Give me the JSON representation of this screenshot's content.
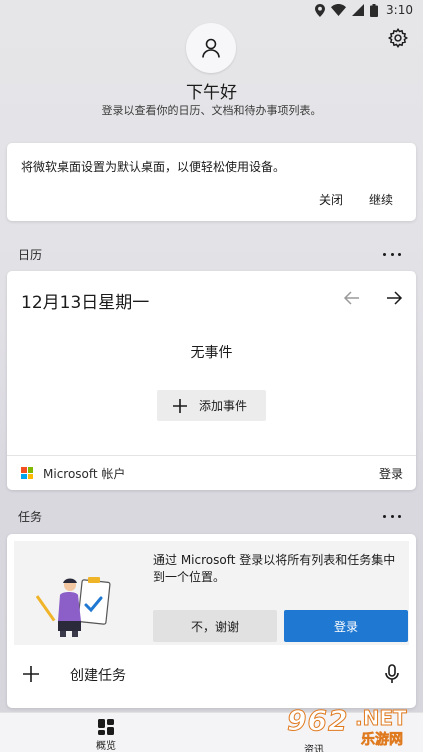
{
  "status_bar": {
    "time": "3:10",
    "icons": [
      "location-icon",
      "wifi-icon",
      "signal-icon",
      "battery-icon"
    ]
  },
  "header": {
    "avatar_icon": "person-icon",
    "settings_icon": "gear-icon",
    "greeting": "下午好",
    "subtitle": "登录以查看你的日历、文档和待办事项列表。"
  },
  "banner": {
    "text": "将微软桌面设置为默认桌面，以便轻松使用设备。",
    "close_label": "关闭",
    "continue_label": "继续"
  },
  "calendar": {
    "section_label": "日历",
    "date": "12月13日星期一",
    "empty_text": "无事件",
    "add_event_label": "添加事件",
    "account_label": "Microsoft 帐户",
    "signin_label": "登录"
  },
  "tasks": {
    "section_label": "任务",
    "promo_text": "通过 Microsoft 登录以将所有列表和任务集中到一个位置。",
    "decline_label": "不，谢谢",
    "signin_label": "登录",
    "create_label": "创建任务"
  },
  "bottom_nav": {
    "overview_label": "概览",
    "news_label": "资讯"
  },
  "watermark": {
    "brand": "962",
    "tld": ".NET",
    "cn": "乐游网"
  },
  "colors": {
    "accent": "#1f78d1",
    "ms_red": "#f25022",
    "ms_green": "#7fba00",
    "ms_blue": "#00a4ef",
    "ms_yellow": "#ffb900"
  }
}
